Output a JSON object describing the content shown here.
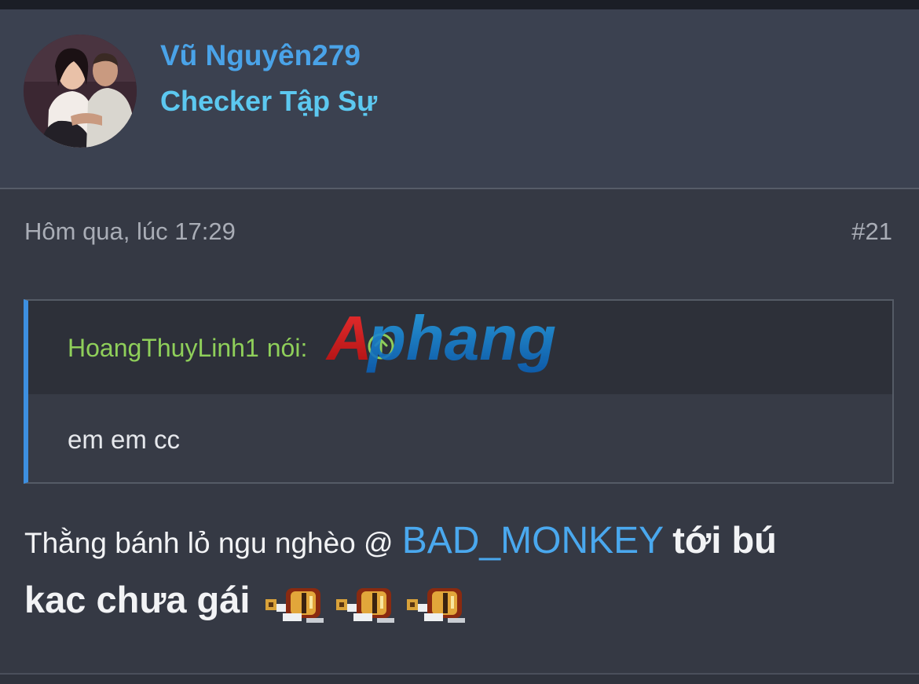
{
  "user": {
    "name": "Vũ Nguyên279",
    "title": "Checker Tập Sự",
    "avatar_icon": "profile-photo-couple"
  },
  "post": {
    "time": "Hôm qua, lúc 17:29",
    "number": "#21"
  },
  "quote": {
    "author": "HoangThuyLinh1",
    "said_label": "nói:",
    "jump_icon": "arrow-up-circle-icon",
    "text": "em em cc"
  },
  "message": {
    "text_before": "Thằng bánh lỏ ngu nghèo @",
    "mention": "BAD_MONKEY",
    "text_after_line1": "tới bú",
    "text_line2": "kac chưa gái",
    "emoji_icon": "pixel-monkey-sticker-icon",
    "emoji_count": 3
  },
  "watermark": {
    "text": "Aphang"
  },
  "colors": {
    "username": "#4aa3e8",
    "user_title": "#5cc8f0",
    "quote_author": "#8fcf5a",
    "quote_bar": "#3d8fe0",
    "mention": "#4aa8ee",
    "background": "#353944"
  }
}
